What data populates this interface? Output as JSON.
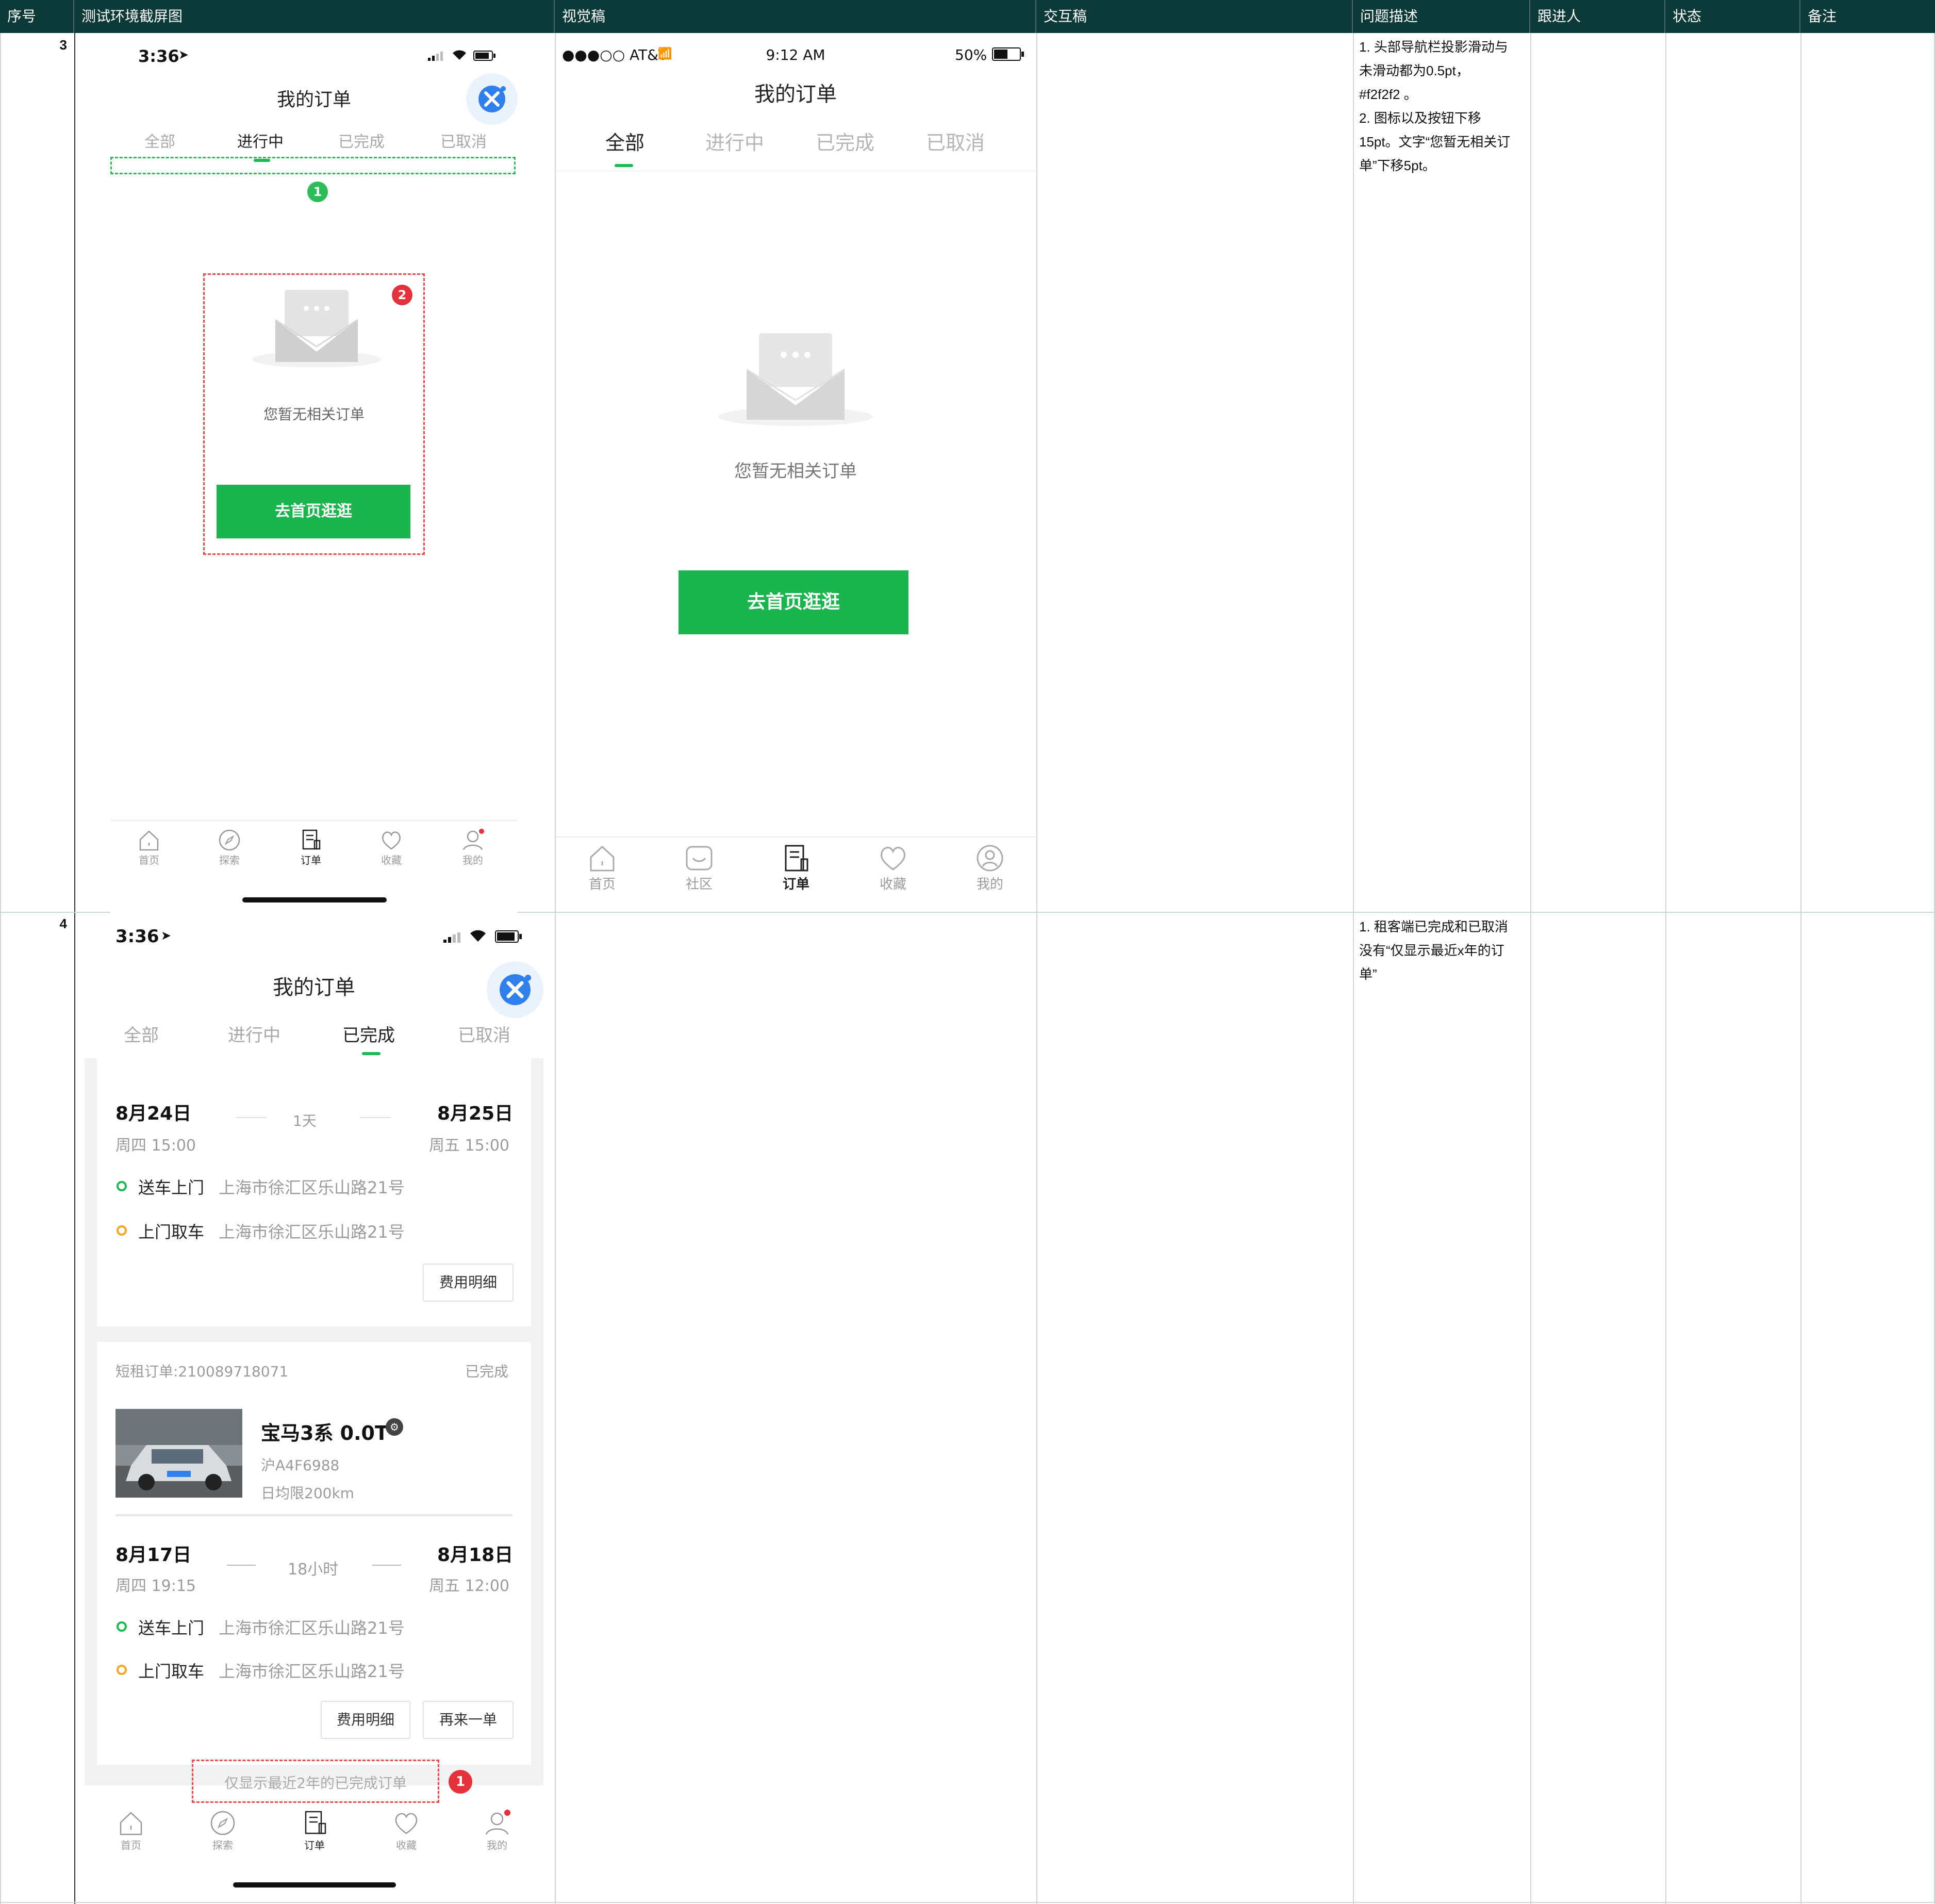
{
  "columns": [
    "序号",
    "测试环境截屏图",
    "视觉稿",
    "交互稿",
    "问题描述",
    "跟进人",
    "状态",
    "备注"
  ],
  "rows": [
    {
      "num": "3",
      "description": "1. 头部导航栏投影滑动与\n未滑动都为0.5pt，\n#f2f2f2 。\n2. 图标以及按钮下移\n15pt。文字“您暂无相关订\n单”下移5pt。"
    },
    {
      "num": "4",
      "description": "1. 租客端已完成和已取消\n没有“仅显示最近x年的订\n单”"
    }
  ],
  "test1": {
    "time": "3:36",
    "title": "我的订单",
    "tabs": [
      "全部",
      "进行中",
      "已完成",
      "已取消"
    ],
    "empty_text": "您暂无相关订单",
    "button": "去首页逛逛",
    "marker1": "1",
    "marker2": "2",
    "nav": [
      "首页",
      "探索",
      "订单",
      "收藏",
      "我的"
    ]
  },
  "visual": {
    "carrier": "●●●○○ AT&T",
    "time": "9:12 AM",
    "battery": "50%",
    "title": "我的订单",
    "tabs": [
      "全部",
      "进行中",
      "已完成",
      "已取消"
    ],
    "empty_text": "您暂无相关订单",
    "button": "去首页逛逛",
    "nav": [
      "首页",
      "社区",
      "订单",
      "收藏",
      "我的"
    ]
  },
  "test2": {
    "time": "3:36",
    "title": "我的订单",
    "tabs": [
      "全部",
      "进行中",
      "已完成",
      "已取消"
    ],
    "card1": {
      "start_date": "8月24日",
      "start_time": "周四 15:00",
      "duration": "1天",
      "end_date": "8月25日",
      "end_time": "周五 15:00",
      "deliver_label": "送车上门",
      "deliver_addr": "上海市徐汇区乐山路21号",
      "pickup_label": "上门取车",
      "pickup_addr": "上海市徐汇区乐山路21号",
      "btn_fee": "费用明细"
    },
    "card2": {
      "order_no": "短租订单:210089718071",
      "status": "已完成",
      "car_name": "宝马3系 0.0T",
      "plate": "沪A4F6988",
      "limit": "日均限200km",
      "start_date": "8月17日",
      "start_time": "周四 19:15",
      "duration": "18小时",
      "end_date": "8月18日",
      "end_time": "周五 12:00",
      "deliver_label": "送车上门",
      "deliver_addr": "上海市徐汇区乐山路21号",
      "pickup_label": "上门取车",
      "pickup_addr": "上海市徐汇区乐山路21号",
      "btn_fee": "费用明细",
      "btn_again": "再来一单"
    },
    "footer_note": "仅显示最近2年的已完成订单",
    "marker1": "1",
    "nav": [
      "首页",
      "探索",
      "订单",
      "收藏",
      "我的"
    ]
  }
}
